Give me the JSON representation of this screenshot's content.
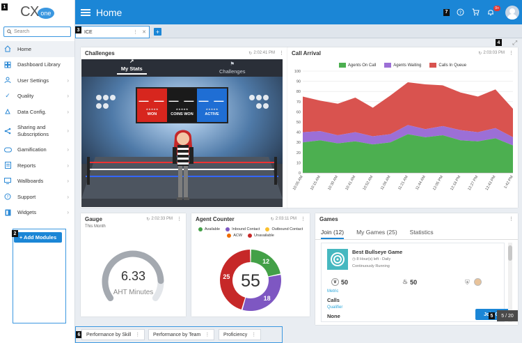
{
  "logo": {
    "cx": "CX",
    "one": "one"
  },
  "search": {
    "placeholder": "Search",
    "icon": "search-icon"
  },
  "sidebar": {
    "items": [
      {
        "label": "Home",
        "icon": "home-icon",
        "active": true,
        "chevron": false
      },
      {
        "label": "Dashboard Library",
        "icon": "dashboard-icon",
        "chevron": false
      },
      {
        "label": "User Settings",
        "icon": "user-icon",
        "chevron": true
      },
      {
        "label": "Quality",
        "icon": "check-icon",
        "chevron": true
      },
      {
        "label": "Data Config.",
        "icon": "data-icon",
        "chevron": true
      },
      {
        "label": "Sharing and Subscriptions",
        "icon": "share-icon",
        "chevron": true
      },
      {
        "label": "Gamification",
        "icon": "gamepad-icon",
        "chevron": true
      },
      {
        "label": "Reports",
        "icon": "report-icon",
        "chevron": true
      },
      {
        "label": "Wallboards",
        "icon": "monitor-icon",
        "chevron": true
      },
      {
        "label": "Support",
        "icon": "help-icon",
        "chevron": true
      },
      {
        "label": "Widgets",
        "icon": "widget-icon",
        "chevron": true
      }
    ],
    "add_modules": "+ Add Modules"
  },
  "header": {
    "title": "Home",
    "notification_badge": "9+"
  },
  "tabbar": {
    "tab_label": "ICE",
    "add": "+"
  },
  "annotations": {
    "n1": "1",
    "n2": "2",
    "n3": "3",
    "n4": "4",
    "n5": "5",
    "n6": "6",
    "n7": "7"
  },
  "challenges": {
    "title": "Challenges",
    "timestamp": "2:02:41 PM",
    "tab_my_stats": "My Stats",
    "tab_challenges": "Challenges",
    "won_value": "— —",
    "won_label": "WON",
    "coins_value": "— —",
    "coins_label": "COINS WON",
    "active_value": "— —",
    "active_label": "ACTIVE",
    "stars": "★★★★★"
  },
  "call_arrival": {
    "title": "Call Arrival",
    "timestamp": "2:03:03 PM",
    "colors": {
      "on_call": "#4caf50",
      "waiting": "#9c6fd6",
      "queue": "#d9534f"
    }
  },
  "chart_data": {
    "type": "area",
    "ylim": [
      0,
      100
    ],
    "yticks": [
      0,
      10,
      20,
      30,
      40,
      50,
      60,
      70,
      80,
      90,
      100
    ],
    "categories": [
      "10:05 AM",
      "10:15 AM",
      "10:30 AM",
      "10:41 AM",
      "10:52 AM",
      "11:06 AM",
      "11:21 AM",
      "11:44 AM",
      "12:05 PM",
      "12:18 PM",
      "12:27 PM",
      "12:43 PM",
      "1:42 PM"
    ],
    "series": [
      {
        "name": "Agents On Call",
        "values": [
          30,
          32,
          29,
          31,
          28,
          30,
          38,
          35,
          37,
          32,
          31,
          34,
          27
        ]
      },
      {
        "name": "Agents Waiting",
        "values": [
          10,
          9,
          8,
          9,
          8,
          8,
          9,
          8,
          9,
          10,
          9,
          10,
          8
        ]
      },
      {
        "name": "Calls In Queue",
        "values": [
          35,
          30,
          31,
          34,
          28,
          38,
          42,
          44,
          40,
          37,
          35,
          38,
          28
        ]
      }
    ]
  },
  "gauge": {
    "title": "Gauge",
    "timestamp": "2:02:33 PM",
    "subtitle": "This Month",
    "value": "6.33",
    "label": "AHT Minutes",
    "fraction": 0.85
  },
  "agent_counter": {
    "title": "Agent Counter",
    "timestamp": "2:03:11 PM",
    "legend": [
      {
        "label": "Available",
        "color": "#43a047"
      },
      {
        "label": "Inbound Contact",
        "color": "#7e57c2"
      },
      {
        "label": "Outbound Contact",
        "color": "#fbc02d"
      },
      {
        "label": "ACW",
        "color": "#ef6c00"
      },
      {
        "label": "Unavailable",
        "color": "#c62828"
      }
    ],
    "total": "55",
    "segments": [
      {
        "label": "12",
        "value": 12,
        "color": "#43a047"
      },
      {
        "label": "18",
        "value": 18,
        "color": "#7e57c2"
      },
      {
        "label": "25",
        "value": 25,
        "color": "#c62828"
      }
    ]
  },
  "games": {
    "title": "Games",
    "tab_join": "Join (12)",
    "tab_my": "My Games (25)",
    "tab_stats": "Statistics",
    "game_title": "Best Bullseye Game",
    "time_left": "8 Hour(s) left - Daily",
    "status": "Continuously Running",
    "stat1": "50",
    "stat2": "50",
    "metric_key": "Metric",
    "metric_value": "Calls",
    "qualifier_key": "Qualifier",
    "qualifier_value": "None",
    "join_button": "Join Ga",
    "pager": "5 / 20"
  },
  "bottom_tabs": [
    "Performance by Skill",
    "Performance by Team",
    "Proficiency"
  ]
}
